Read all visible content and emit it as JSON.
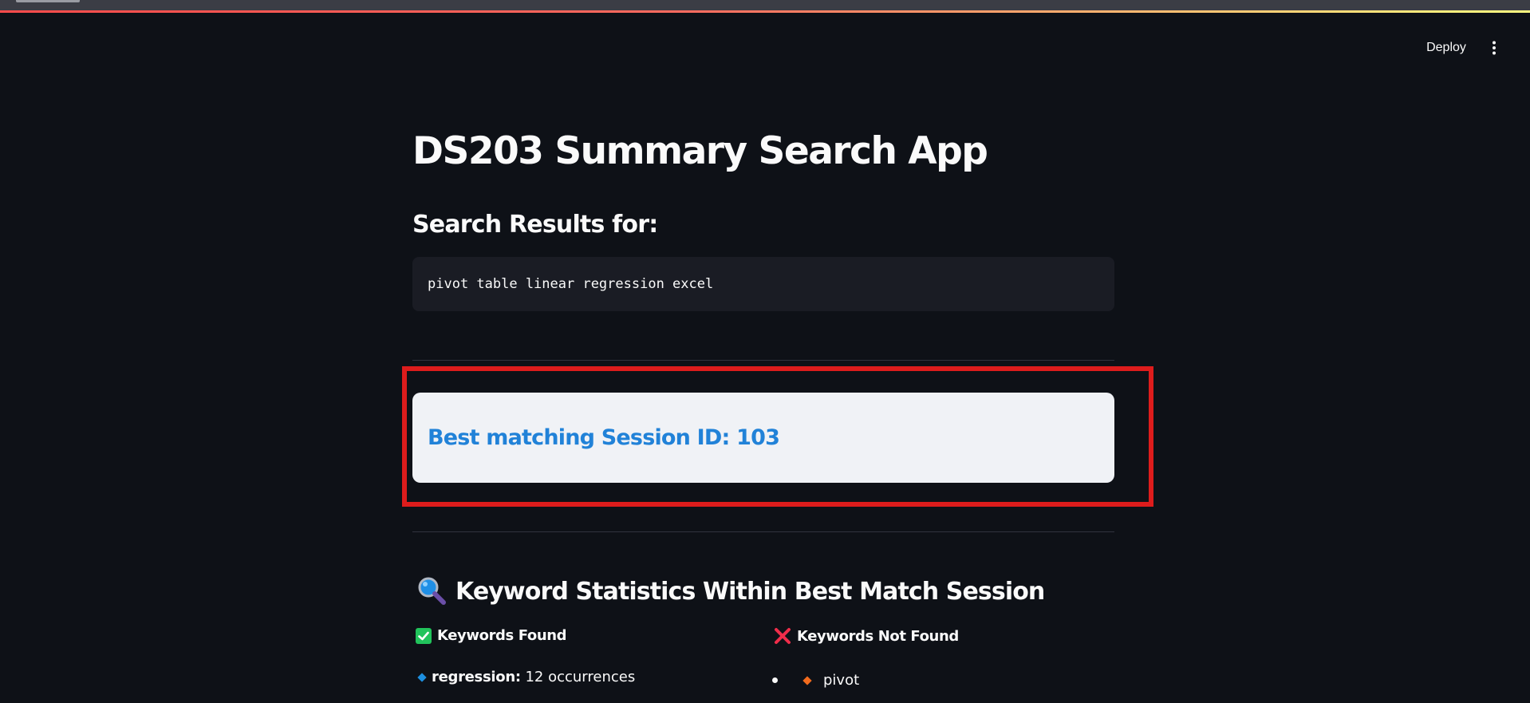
{
  "header": {
    "deploy_label": "Deploy",
    "menu_icon": "more-vertical-icon"
  },
  "main": {
    "title": "DS203 Summary Search App",
    "results_heading": "Search Results for:",
    "query": "pivot table linear regression excel",
    "best_match": "Best matching Session ID: 103",
    "stats_heading": "Keyword Statistics Within Best Match Session",
    "stats_icon": "magnifying-glass-icon",
    "found": {
      "header": "Keywords Found",
      "icon": "check-box-icon",
      "items": [
        {
          "keyword": "regression:",
          "occurrences": "12 occurrences"
        }
      ]
    },
    "not_found": {
      "header": "Keywords Not Found",
      "icon": "cross-mark-icon",
      "items": [
        "pivot"
      ]
    }
  },
  "colors": {
    "background": "#0e1117",
    "card": "#f0f2f6",
    "link_blue": "#2182d8",
    "highlight_red": "#dd1c1c",
    "code_bg": "#1a1c24"
  }
}
